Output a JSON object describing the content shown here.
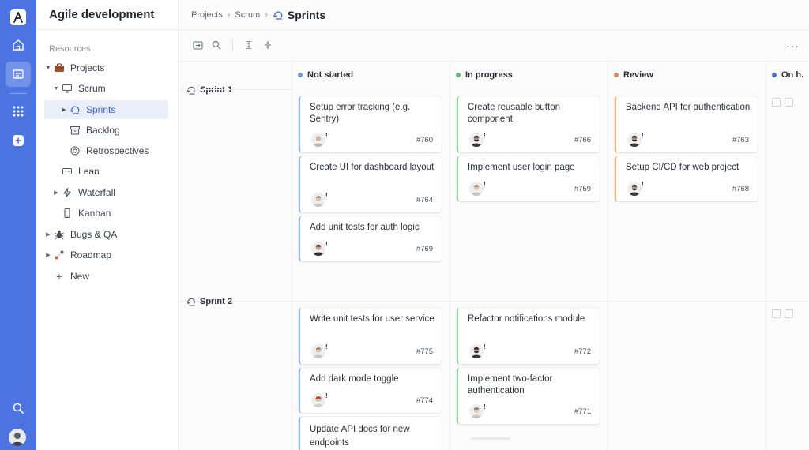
{
  "workspace": {
    "title": "Agile development"
  },
  "rail": {
    "items": [
      {
        "icon": "logo-icon"
      },
      {
        "icon": "home-icon"
      },
      {
        "icon": "board-icon",
        "active": true
      },
      {
        "icon": "apps-grid-icon"
      },
      {
        "icon": "add-icon"
      },
      {
        "icon": "search-icon"
      },
      {
        "icon": "user-avatar"
      }
    ]
  },
  "sidebar": {
    "section_label": "Resources",
    "tree": [
      {
        "label": "Projects",
        "icon": "briefcase-icon",
        "expanded": true
      },
      {
        "label": "Scrum",
        "icon": "monitor-icon",
        "expanded": true
      },
      {
        "label": "Sprints",
        "icon": "sprint-icon",
        "active": true
      },
      {
        "label": "Backlog",
        "icon": "archive-icon"
      },
      {
        "label": "Retrospectives",
        "icon": "retro-icon"
      },
      {
        "label": "Lean",
        "icon": "lean-icon"
      },
      {
        "label": "Waterfall",
        "icon": "bolt-icon"
      },
      {
        "label": "Kanban",
        "icon": "phone-icon"
      },
      {
        "label": "Bugs & QA",
        "icon": "bug-icon"
      },
      {
        "label": "Roadmap",
        "icon": "roadmap-icon"
      },
      {
        "label": "New",
        "icon": "plus-icon"
      }
    ]
  },
  "breadcrumb": {
    "items": [
      "Projects",
      "Scrum"
    ],
    "current": "Sprints"
  },
  "toolbar": {
    "more_label": "···"
  },
  "columns": [
    {
      "label": "Not started",
      "color": "#6f9be6"
    },
    {
      "label": "In progress",
      "color": "#5cbf6f"
    },
    {
      "label": "Review",
      "color": "#e58a4c"
    },
    {
      "label": "On h.",
      "color": "#3f6fe0"
    }
  ],
  "sprints": [
    {
      "label": "Sprint 1",
      "cards": [
        {
          "column": "not-started",
          "title": "Setup error tracking (e.g. Sentry)",
          "id": "#760"
        },
        {
          "column": "not-started",
          "title": "Create UI for dashboard layout",
          "id": "#764"
        },
        {
          "column": "not-started",
          "title": "Add unit tests for auth logic",
          "id": "#769"
        },
        {
          "column": "in-progress",
          "title": "Create reusable button component",
          "id": "#766"
        },
        {
          "column": "in-progress",
          "title": "Implement user login page",
          "id": "#759"
        },
        {
          "column": "review",
          "title": "Backend API for authentication",
          "id": "#763"
        },
        {
          "column": "review",
          "title": "Setup CI/CD for web project",
          "id": "#768"
        }
      ]
    },
    {
      "label": "Sprint 2",
      "cards": [
        {
          "column": "not-started",
          "title": "Write unit tests for user service",
          "id": "#775"
        },
        {
          "column": "not-started",
          "title": "Add dark mode toggle",
          "id": "#774"
        },
        {
          "column": "not-started",
          "title": "Update API docs for new endpoints",
          "id": ""
        },
        {
          "column": "in-progress",
          "title": "Refactor notifications module",
          "id": "#772"
        },
        {
          "column": "in-progress",
          "title": "Implement two-factor authentication",
          "id": "#771"
        }
      ]
    }
  ],
  "card_flag": "!"
}
